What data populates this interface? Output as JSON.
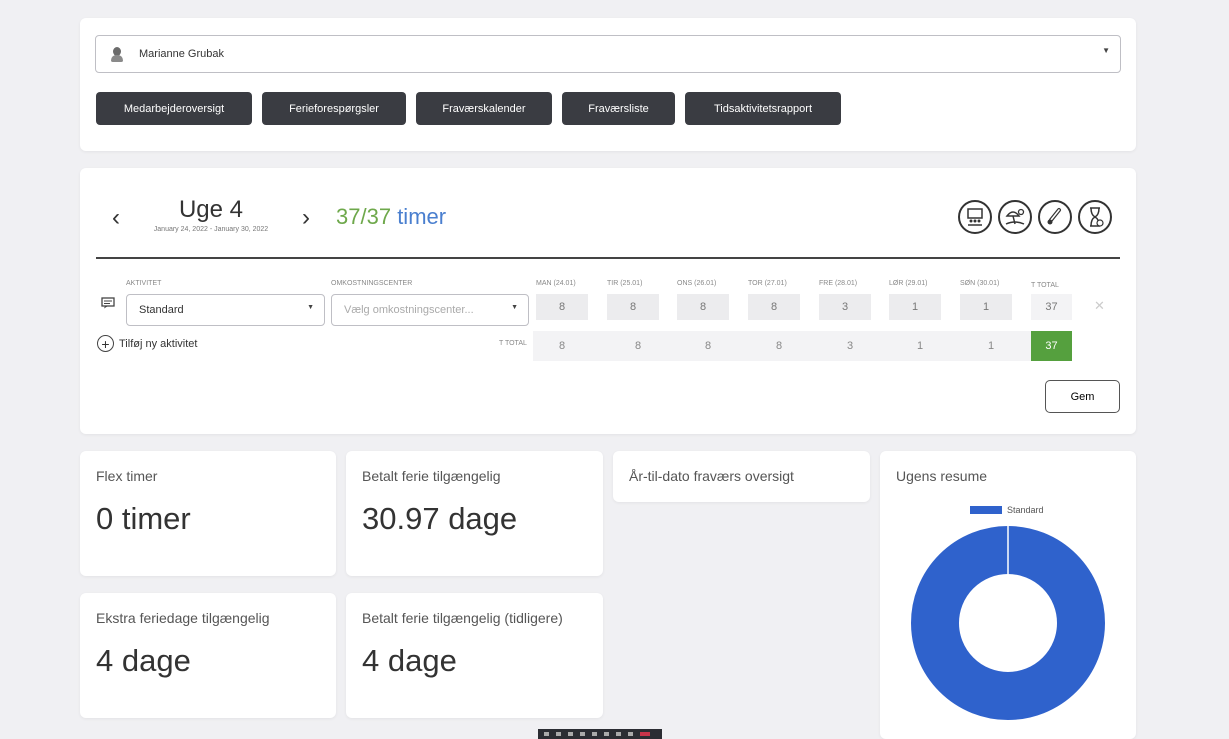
{
  "employee": {
    "name": "Marianne Grubak"
  },
  "nav": [
    "Medarbejderoversigt",
    "Ferieforespørgsler",
    "Fraværskalender",
    "Fraværsliste",
    "Tidsaktivitetsrapport"
  ],
  "week": {
    "title": "Uge 4",
    "range": "January 24, 2022 - January 30, 2022",
    "hours_done": "37/37",
    "hours_label": "timer"
  },
  "header_icons": [
    "team-overview-icon",
    "vacation-icon",
    "sick-thermometer-icon",
    "hourglass-icon"
  ],
  "table": {
    "col_activity": "AKTIVITET",
    "col_cost": "OMKOSTNINGSCENTER",
    "days": [
      "MAN (24.01)",
      "TIR (25.01)",
      "ONS (26.01)",
      "TOR (27.01)",
      "FRE (28.01)",
      "LØR (29.01)",
      "SØN (30.01)"
    ],
    "col_total": "T TOTAL",
    "activity": "Standard",
    "cost_placeholder": "Vælg omkostningscenter...",
    "row_values": [
      "8",
      "8",
      "8",
      "8",
      "3",
      "1",
      "1"
    ],
    "row_total": "37",
    "add_activity": "Tilføj ny aktivitet",
    "totals_label": "T TOTAL",
    "totals": [
      "8",
      "8",
      "8",
      "8",
      "3",
      "1",
      "1"
    ],
    "grand_total": "37",
    "save": "Gem"
  },
  "stats": {
    "flex": {
      "title": "Flex timer",
      "value": "0 timer"
    },
    "paid_vacation": {
      "title": "Betalt ferie tilgængelig",
      "value": "30.97 dage"
    },
    "ytd_absence": {
      "title": "År-til-dato fraværs oversigt"
    },
    "extra_vacation": {
      "title": "Ekstra feriedage tilgængelig",
      "value": "4 dage"
    },
    "paid_vacation_prev": {
      "title": "Betalt ferie tilgængelig (tidligere)",
      "value": "4 dage"
    }
  },
  "summary": {
    "title": "Ugens resume",
    "chart_data": {
      "type": "pie",
      "categories": [
        "Standard"
      ],
      "values": [
        37
      ],
      "legend": "top",
      "colors": [
        "#2f62cc"
      ]
    }
  },
  "colors": {
    "accent_green": "#6ea84b",
    "accent_blue": "#4a7fcf",
    "dark_button": "#3a3c42",
    "total_green": "#55a03e",
    "chart_blue": "#2f62cc"
  }
}
